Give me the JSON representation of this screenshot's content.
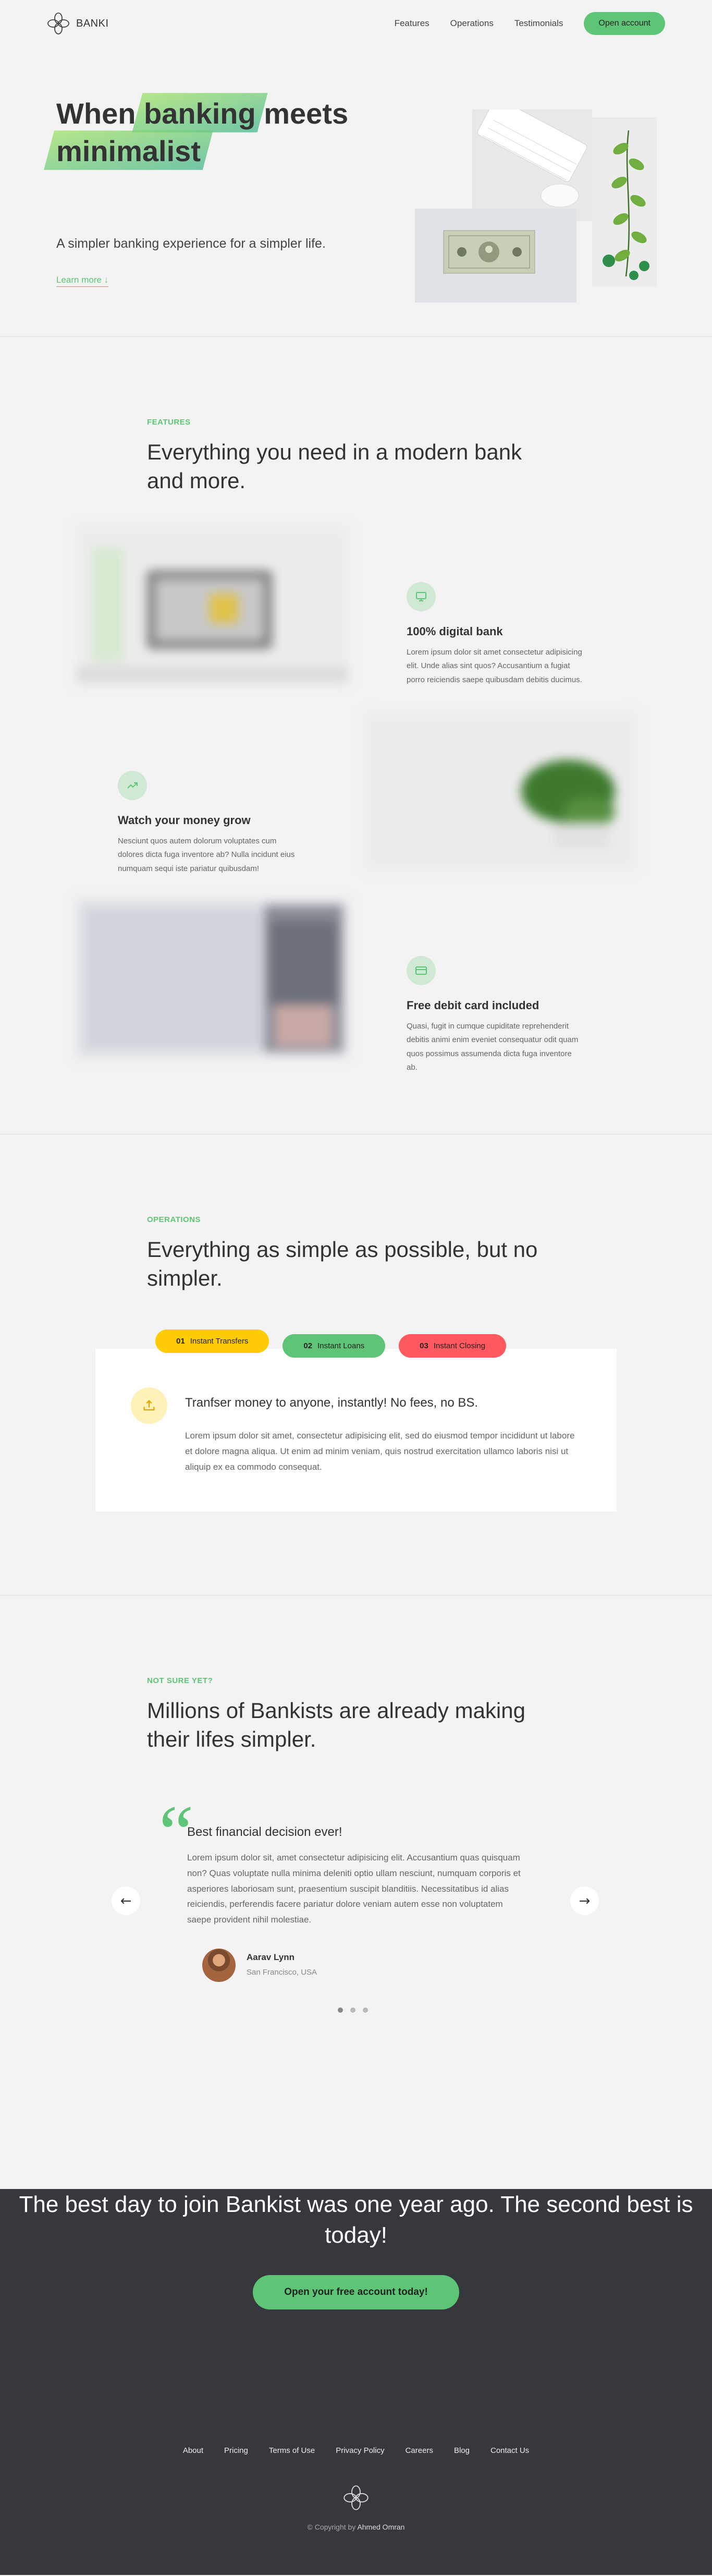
{
  "nav": {
    "brand": "BANKI",
    "links": [
      "Features",
      "Operations",
      "Testimonials"
    ],
    "cta": "Open account"
  },
  "hero": {
    "title_part1": "When",
    "title_highlight1": "banking",
    "title_part2": "meets",
    "title_highlight2": "minimalist",
    "subtitle": "A simpler banking experience for a simpler life.",
    "learn_more": "Learn more ↓"
  },
  "features": {
    "label": "Features",
    "title": "Everything you need in a modern bank and more.",
    "items": [
      {
        "title": "100% digital bank",
        "text": "Lorem ipsum dolor sit amet consectetur adipisicing elit. Unde alias sint quos? Accusantium a fugiat porro reiciendis saepe quibusdam debitis ducimus."
      },
      {
        "title": "Watch your money grow",
        "text": "Nesciunt quos autem dolorum voluptates cum dolores dicta fuga inventore ab? Nulla incidunt eius numquam sequi iste pariatur quibusdam!"
      },
      {
        "title": "Free debit card included",
        "text": "Quasi, fugit in cumque cupiditate reprehenderit debitis animi enim eveniet consequatur odit quam quos possimus assumenda dicta fuga inventore ab."
      }
    ]
  },
  "operations": {
    "label": "Operations",
    "title": "Everything as simple as possible, but no simpler.",
    "tabs": [
      {
        "num": "01",
        "label": "Instant Transfers",
        "color": "#ffcb03"
      },
      {
        "num": "02",
        "label": "Instant Loans",
        "color": "#5ec576"
      },
      {
        "num": "03",
        "label": "Instant Closing",
        "color": "#ff585f"
      }
    ],
    "content_title": "Tranfser money to anyone, instantly! No fees, no BS.",
    "content_text": "Lorem ipsum dolor sit amet, consectetur adipisicing elit, sed do eiusmod tempor incididunt ut labore et dolore magna aliqua. Ut enim ad minim veniam, quis nostrud exercitation ullamco laboris nisi ut aliquip ex ea commodo consequat."
  },
  "testimonials": {
    "label": "Not sure yet?",
    "title": "Millions of Bankists are already making their lifes simpler.",
    "quote_title": "Best financial decision ever!",
    "quote_text": "Lorem ipsum dolor sit, amet consectetur adipisicing elit. Accusantium quas quisquam non? Quas voluptate nulla minima deleniti optio ullam nesciunt, numquam corporis et asperiores laboriosam sunt, praesentium suscipit blanditiis. Necessitatibus id alias reiciendis, perferendis facere pariatur dolore veniam autem esse non voluptatem saepe provident nihil molestiae.",
    "author_name": "Aarav Lynn",
    "author_location": "San Francisco, USA"
  },
  "signup": {
    "title": "The best day to join Bankist was one year ago. The second best is today!",
    "button": "Open your free account today!"
  },
  "footer": {
    "links": [
      "About",
      "Pricing",
      "Terms of Use",
      "Privacy Policy",
      "Careers",
      "Blog",
      "Contact Us"
    ],
    "copyright_prefix": "© Copyright by",
    "copyright_author": "Ahmed Omran"
  },
  "colors": {
    "accent_green": "#5ec576",
    "accent_yellow": "#ffcb03",
    "accent_red": "#ff585f",
    "dark_bg": "#37383d"
  }
}
